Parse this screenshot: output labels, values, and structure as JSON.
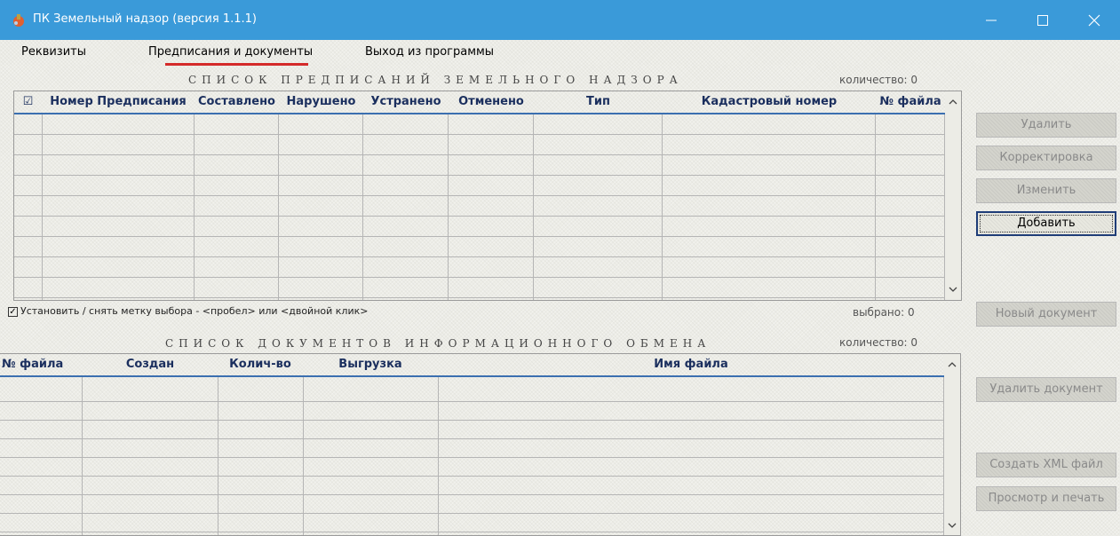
{
  "window": {
    "title": "ПК Земельный надзор  (версия 1.1.1)",
    "controls": [
      "minimize",
      "maximize",
      "close"
    ]
  },
  "menu": {
    "items": [
      "Реквизиты",
      "Предписания и документы",
      "Выход из программы"
    ],
    "active_index": 1
  },
  "prescriptions": {
    "title": "СПИСОК ПРЕДПИСАНИЙ ЗЕМЕЛЬНОГО НАДЗОРА",
    "count_label": "количество: 0",
    "columns": [
      "☑",
      "Номер Предписания",
      "Составлено",
      "Нарушено",
      "Устранено",
      "Отменено",
      "Тип",
      "Кадастровый номер",
      "№ файла"
    ],
    "rows": [],
    "hint": "Установить / снять метку выбора - <пробел> или <двойной клик>",
    "selected_label": "выбрано: 0"
  },
  "documents": {
    "title": "СПИСОК ДОКУМЕНТОВ ИНФОРМАЦИОННОГО ОБМЕНА",
    "count_label": "количество: 0",
    "columns": [
      "№ файла",
      "Создан",
      "Колич-во",
      "Выгрузка",
      "Имя файла"
    ],
    "rows": []
  },
  "buttons": {
    "delete": "Удалить",
    "correction": "Корректировка",
    "edit": "Изменить",
    "add": "Добавить",
    "new_document": "Новый документ",
    "delete_document": "Удалить документ",
    "create_xml": "Создать XML файл",
    "preview_print": "Просмотр и печать"
  },
  "colors": {
    "titlebar": "#3a9ad9",
    "menu_underline": "#d42a2a",
    "header_text": "#1b2f5e"
  }
}
